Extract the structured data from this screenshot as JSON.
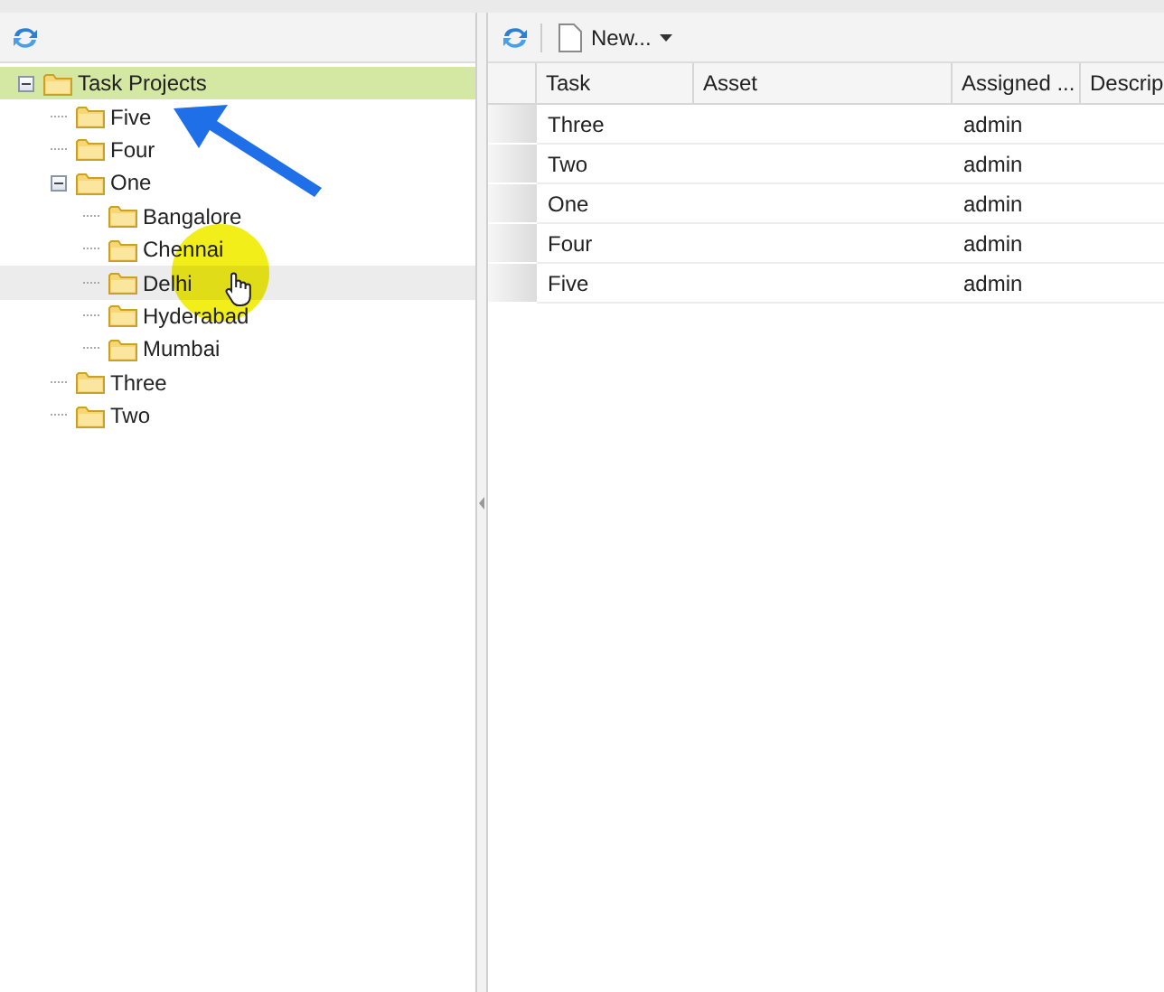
{
  "tree": {
    "items": [
      {
        "label": "Task Projects",
        "expanded": true,
        "selected": true,
        "hovered": false,
        "children": [
          {
            "label": "Five",
            "selected": false,
            "hovered": false
          },
          {
            "label": "Four",
            "selected": false,
            "hovered": false
          },
          {
            "label": "One",
            "expanded": true,
            "selected": false,
            "hovered": false,
            "children": [
              {
                "label": "Bangalore",
                "selected": false,
                "hovered": false
              },
              {
                "label": "Chennai",
                "selected": false,
                "hovered": false
              },
              {
                "label": "Delhi",
                "selected": false,
                "hovered": true
              },
              {
                "label": "Hyderabad",
                "selected": false,
                "hovered": false
              },
              {
                "label": "Mumbai",
                "selected": false,
                "hovered": false
              }
            ]
          },
          {
            "label": "Three",
            "selected": false,
            "hovered": false
          },
          {
            "label": "Two",
            "selected": false,
            "hovered": false
          }
        ]
      }
    ]
  },
  "toolbar": {
    "new_button": "New..."
  },
  "table": {
    "columns": [
      "Task",
      "Asset",
      "Assigned ...",
      "Descrip"
    ],
    "rows": [
      [
        "Three",
        "",
        "admin",
        ""
      ],
      [
        "Two",
        "",
        "admin",
        ""
      ],
      [
        "One",
        "",
        "admin",
        ""
      ],
      [
        "Four",
        "",
        "admin",
        ""
      ],
      [
        "Five",
        "",
        "admin",
        ""
      ]
    ]
  }
}
